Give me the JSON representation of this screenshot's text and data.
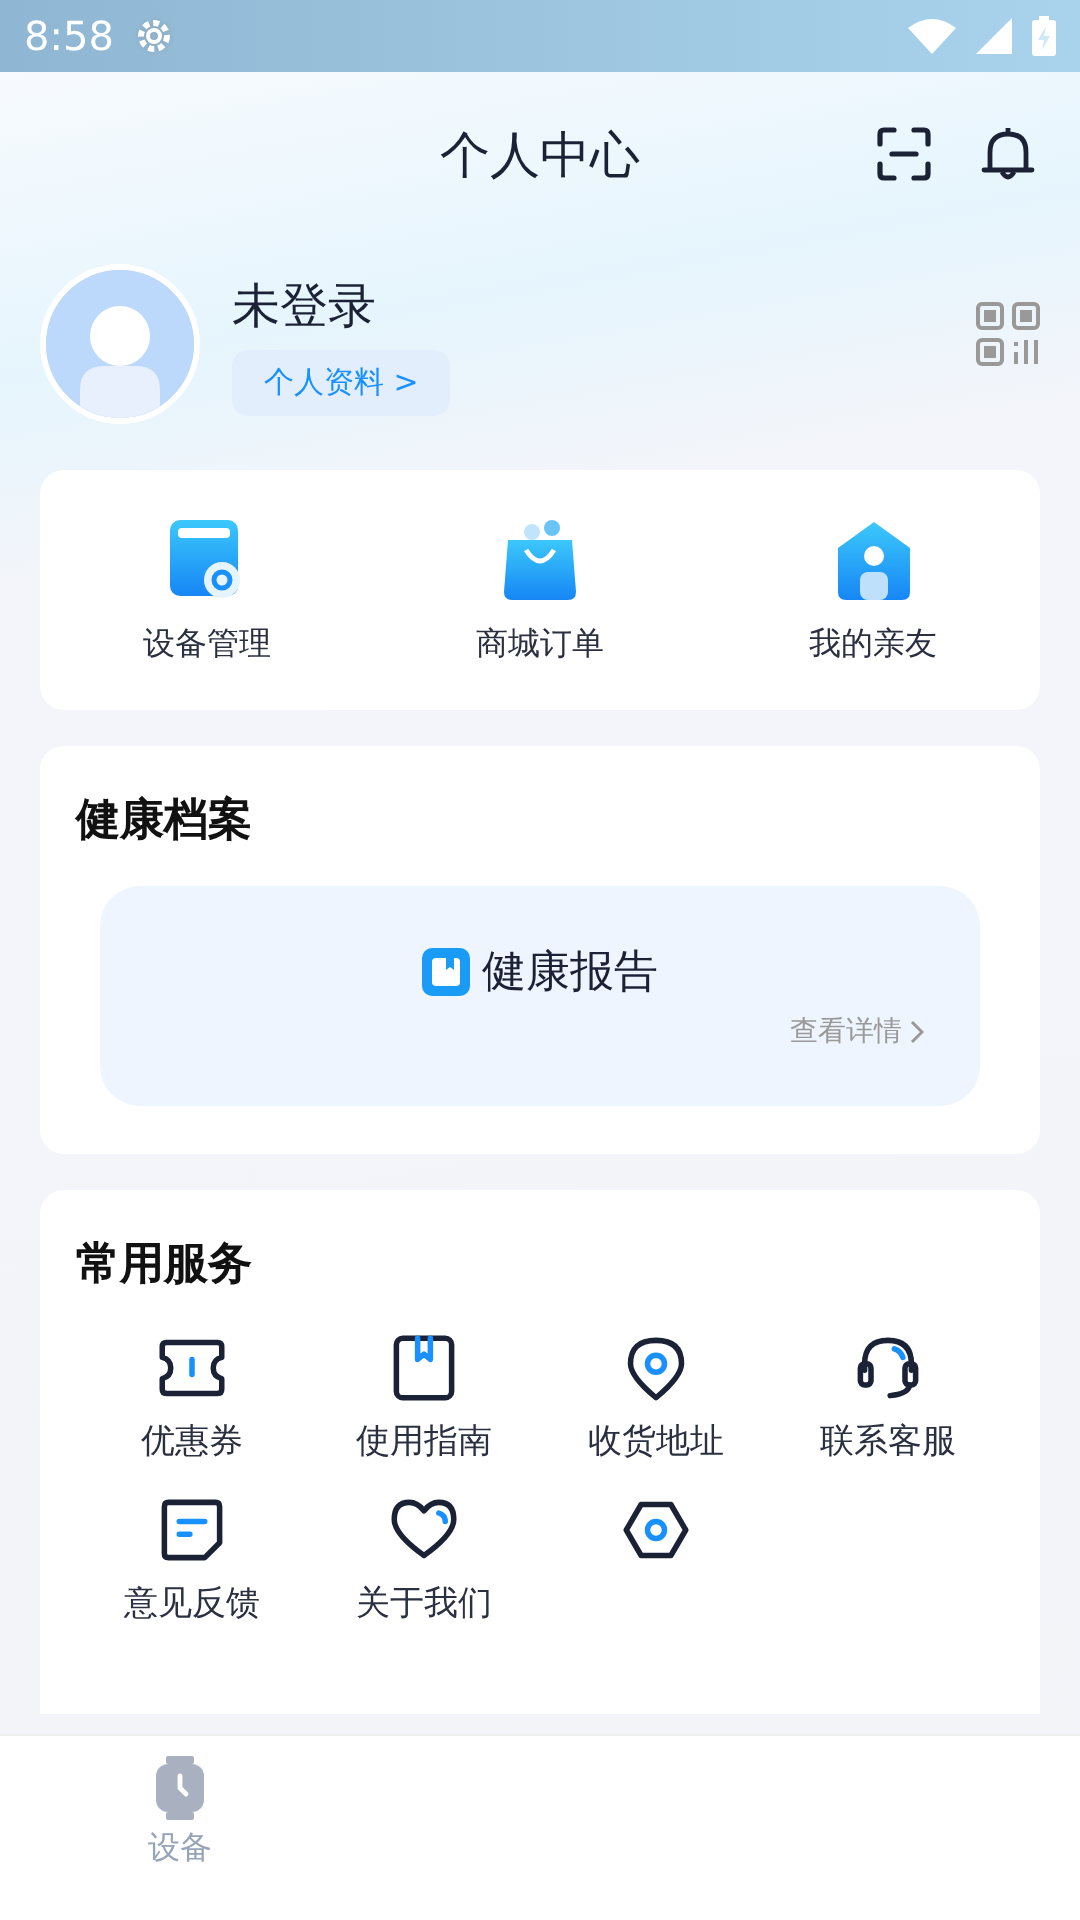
{
  "status_bar": {
    "time": "8:58"
  },
  "header": {
    "title": "个人中心"
  },
  "profile": {
    "name": "未登录",
    "link": "个人资料 >"
  },
  "quick_actions": [
    {
      "label": "设备管理"
    },
    {
      "label": "商城订单"
    },
    {
      "label": "我的亲友"
    }
  ],
  "health": {
    "title": "健康档案",
    "report": "健康报告",
    "details": "查看详情"
  },
  "services": {
    "title": "常用服务",
    "items": [
      {
        "kind": "labeled",
        "label": "优惠券"
      },
      {
        "kind": "labeled",
        "label": "使用指南"
      },
      {
        "kind": "labeled",
        "label": "收货地址"
      },
      {
        "kind": "labeled",
        "label": "联系客服"
      },
      {
        "kind": "labeled",
        "label": "意见反馈"
      },
      {
        "kind": "labeled",
        "label": "关于我们"
      },
      {
        "kind": "icon_only"
      }
    ]
  },
  "bottom_nav": [
    {
      "label": "设备",
      "selected": false
    }
  ]
}
